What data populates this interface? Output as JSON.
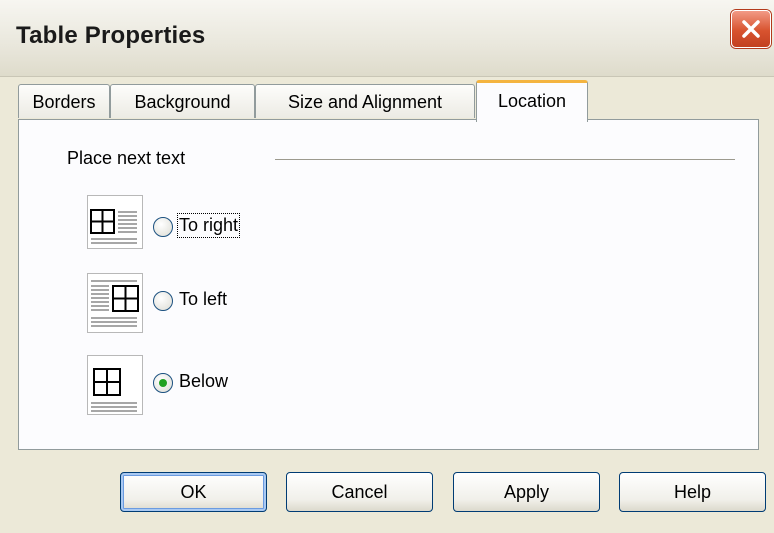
{
  "window": {
    "title": "Table Properties",
    "close_icon": "close-icon",
    "close_color": "#d8532f"
  },
  "tabs": [
    {
      "label": "Borders",
      "active": false
    },
    {
      "label": "Background",
      "active": false
    },
    {
      "label": "Size and Alignment",
      "active": false
    },
    {
      "label": "Location",
      "active": true
    }
  ],
  "location": {
    "group_label": "Place next text",
    "options": [
      {
        "label": "To right",
        "checked": false,
        "icon": "table-left-text-right-icon"
      },
      {
        "label": "To left",
        "checked": false,
        "icon": "table-right-text-left-icon"
      },
      {
        "label": "Below",
        "checked": true,
        "icon": "table-text-below-icon"
      }
    ]
  },
  "buttons": {
    "ok": "OK",
    "cancel": "Cancel",
    "apply": "Apply",
    "help": "Help"
  },
  "colors": {
    "active_tab_accent": "#f4b440",
    "radio_dot": "#21a121",
    "button_border": "#003c74"
  }
}
